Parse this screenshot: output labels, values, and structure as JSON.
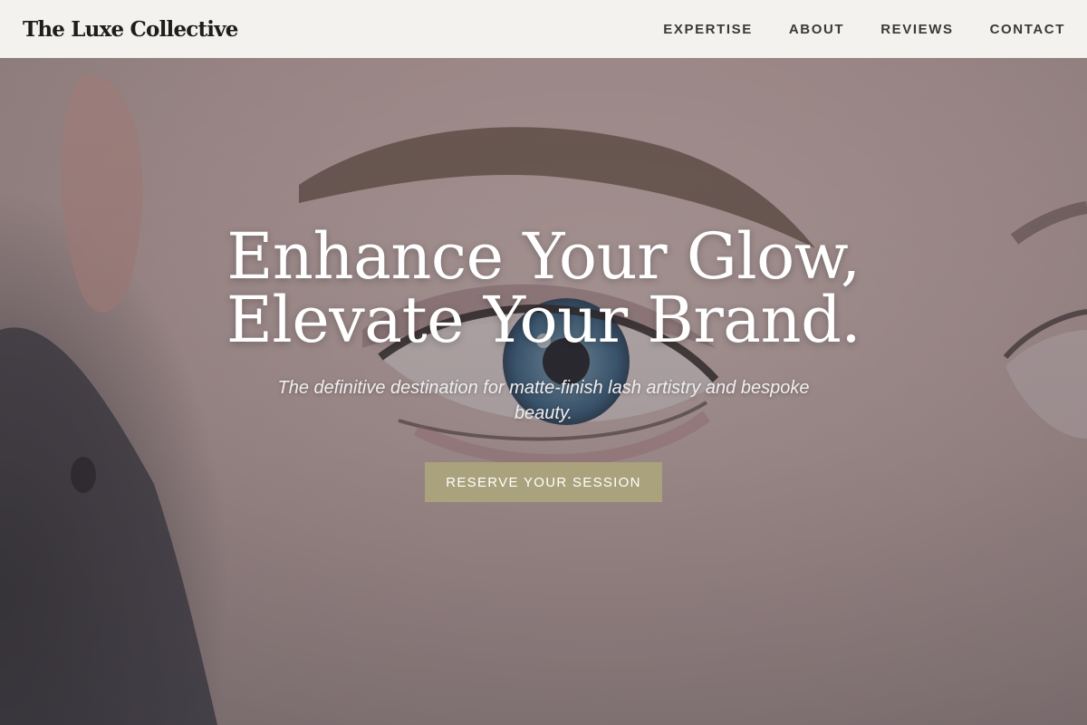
{
  "header": {
    "brand": "The Luxe Collective",
    "nav": [
      {
        "label": "EXPERTISE"
      },
      {
        "label": "ABOUT"
      },
      {
        "label": "REVIEWS"
      },
      {
        "label": "CONTACT"
      }
    ]
  },
  "hero": {
    "headline_line1": "Enhance Your Glow,",
    "headline_line2": "Elevate Your Brand.",
    "subtitle": "The definitive destination for matte-finish lash artistry and bespoke beauty.",
    "cta_label": "RESERVE YOUR SESSION"
  },
  "colors": {
    "header_bg": "#f3f2ee",
    "accent": "#a9a27d",
    "text_dark": "#1f1d1b",
    "hero_text": "#ffffff"
  }
}
